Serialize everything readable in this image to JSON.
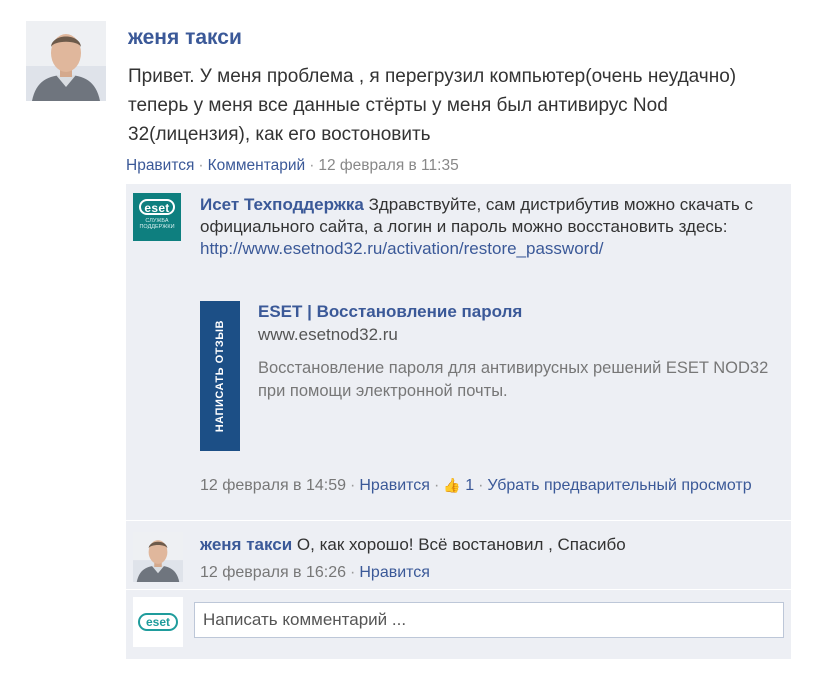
{
  "post": {
    "author": "женя такси",
    "text": "Привет. У меня проблема , я перегрузил компьютер(очень неудачно) теперь у меня все данные стёрты у меня был антивирус Nod 32(лицензия), как его востоновить",
    "like_label": "Нравится",
    "comment_label": "Комментарий",
    "timestamp": "12 февраля в 11:35"
  },
  "comments": [
    {
      "author": "Исет Техподдержка",
      "avatar_logo": "eset",
      "avatar_subtext": "СЛУЖБА ПОДДЕРЖКИ",
      "text": "Здравствуйте, сам дистрибутив можно скачать с официального сайта, а логин и пароль можно восстановить здесь:",
      "url": "http://www.esetnod32.ru/activation/restore_password/",
      "preview": {
        "tab_label": "НАПИСАТЬ ОТЗЫВ",
        "title": "ESET | Восстановление пароля",
        "domain": "www.esetnod32.ru",
        "description": "Восстановление пароля для антивирусных решений ESET NOD32 при помощи электронной почты."
      },
      "timestamp": "12 февраля в 14:59",
      "like_label": "Нравится",
      "like_count": "1",
      "remove_preview_label": "Убрать предварительный просмотр"
    },
    {
      "author": "женя такси",
      "text": "О, как хорошо! Всё востановил , Спасибо",
      "timestamp": "12 февраля в 16:26",
      "like_label": "Нравится"
    }
  ],
  "compose": {
    "avatar_logo": "eset",
    "placeholder": "Написать комментарий ..."
  },
  "colors": {
    "link": "#3b5998",
    "comment_bg": "#edeff4",
    "eset_teal": "#0e7f7f",
    "preview_tab": "#1c4f86"
  },
  "icons": {
    "like": "thumbs-up-icon"
  }
}
